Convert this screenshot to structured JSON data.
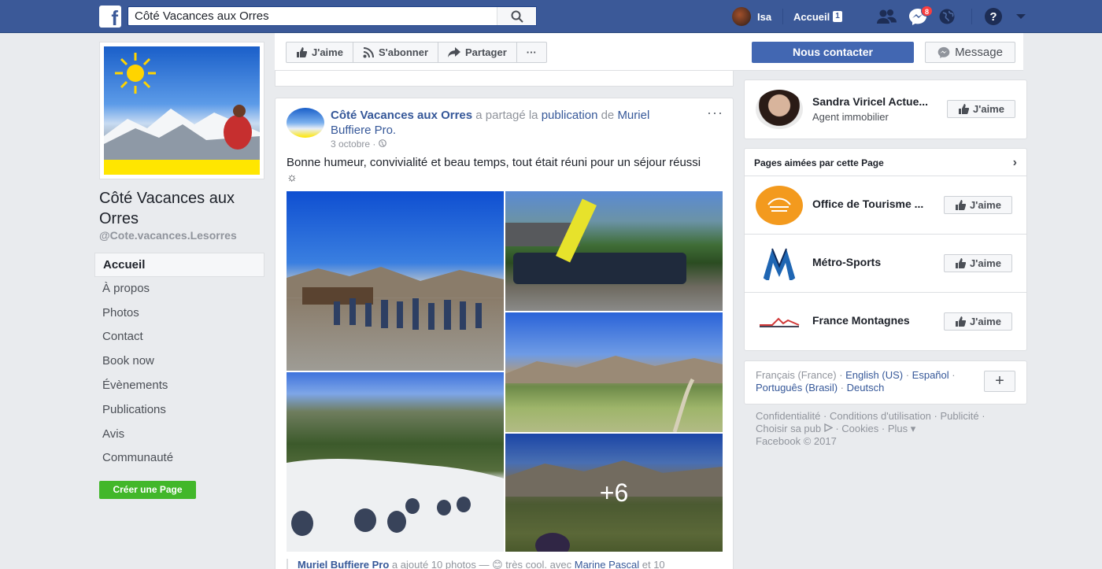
{
  "topbar": {
    "logo": "f",
    "search_value": "Côté Vacances aux Orres",
    "user_name": "Isa",
    "home_label": "Accueil",
    "home_count": "1",
    "messages_badge": "8",
    "icons": [
      "search-icon",
      "friends-icon",
      "messenger-icon",
      "globe-icon",
      "help-icon",
      "chevron-down-icon"
    ]
  },
  "page": {
    "name": "Côté Vacances aux Orres",
    "handle": "@Cote.vacances.Lesorres",
    "nav": [
      {
        "label": "Accueil",
        "active": true
      },
      {
        "label": "À propos"
      },
      {
        "label": "Photos"
      },
      {
        "label": "Contact"
      },
      {
        "label": "Book now"
      },
      {
        "label": "Évènements"
      },
      {
        "label": "Publications"
      },
      {
        "label": "Avis"
      },
      {
        "label": "Communauté"
      }
    ],
    "create_page": "Créer une Page"
  },
  "actions": {
    "like": "J'aime",
    "subscribe": "S'abonner",
    "share": "Partager",
    "more": "···",
    "contact": "Nous contacter",
    "message": "Message"
  },
  "post": {
    "author": "Côté Vacances aux Orres",
    "shared_text": "a partagé la",
    "publication": "publication",
    "from": "de",
    "source": "Muriel Buffiere Pro.",
    "date": "3 octobre",
    "text": "Bonne humeur, convivialité et beau temps, tout était réuni pour un séjour réussi ☼",
    "more_photos": "+6",
    "footer_author": "Muriel Buffiere Pro",
    "footer_text": "a ajouté 10 photos — 😊 très cool. avec",
    "footer_tag": "Marine Pascal",
    "footer_rest": "et 10"
  },
  "right": {
    "top_person": {
      "name": "Sandra Viricel Actue...",
      "role": "Agent immobilier",
      "like": "J'aime"
    },
    "liked_pages_title": "Pages aimées par cette Page",
    "liked_pages": [
      {
        "name": "Office de Tourisme ...",
        "like": "J'aime"
      },
      {
        "name": "Métro-Sports",
        "like": "J'aime"
      },
      {
        "name": "France Montagnes",
        "like": "J'aime"
      }
    ],
    "languages": [
      "Français (France)",
      "English (US)",
      "Español",
      "Português (Brasil)",
      "Deutsch"
    ],
    "footer_links": [
      "Confidentialité",
      "Conditions d'utilisation",
      "Publicité",
      "Choisir sa pub",
      "Cookies",
      "Plus"
    ],
    "copyright": "Facebook © 2017"
  }
}
